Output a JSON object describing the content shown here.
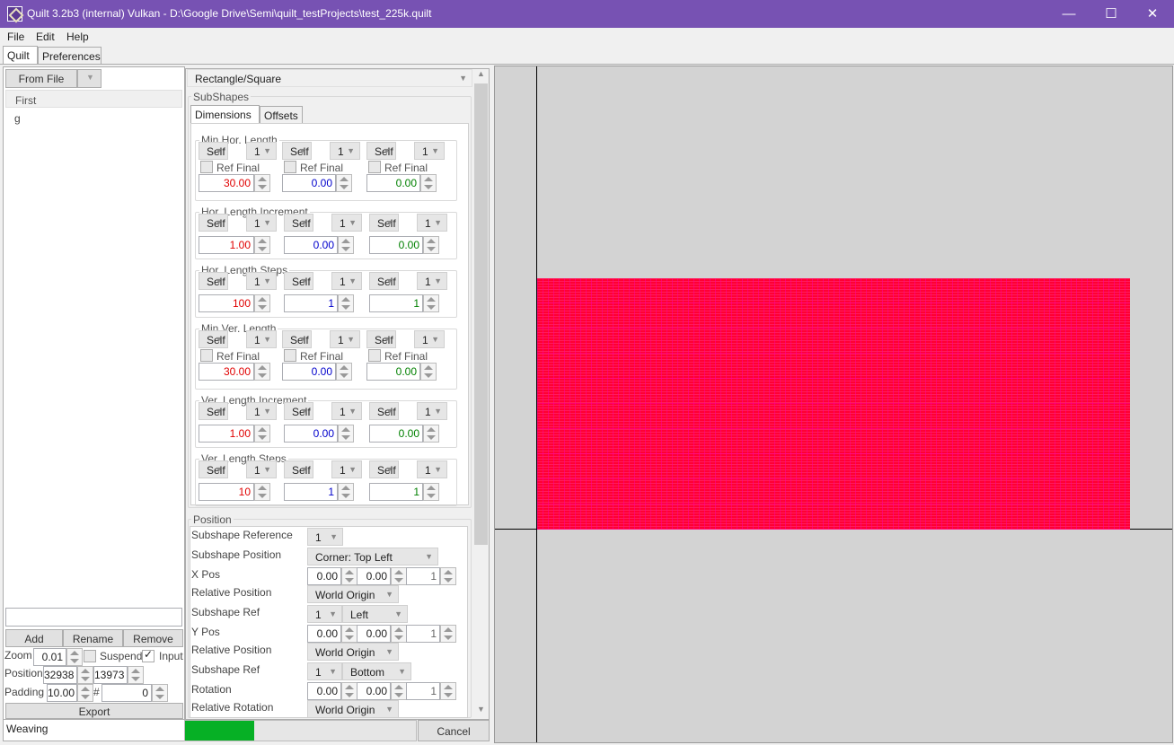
{
  "window": {
    "title": "Quilt 3.2b3 (internal) Vulkan - D:\\Google Drive\\Semi\\quilt_testProjects\\test_225k.quilt",
    "minimize": "—",
    "maximize": "☐",
    "close": "✕"
  },
  "menu": [
    "File",
    "Edit",
    "Help"
  ],
  "tabs": [
    "Quilt",
    "Preferences"
  ],
  "left": {
    "from_file": "From File",
    "list_header": "First",
    "list_items": [
      "g"
    ],
    "add": "Add",
    "rename": "Rename",
    "remove": "Remove",
    "zoom_label": "Zoom",
    "zoom": "0.01",
    "suspend": "Suspend",
    "input": "Input",
    "position_label": "Position",
    "pos_x": "32938",
    "pos_y": "13973",
    "padding_label": "Padding",
    "padding": "10.00",
    "hash": "#",
    "hash_val": "0",
    "export": "Export",
    "status": "Weaving"
  },
  "shape": {
    "type": "Rectangle/Square",
    "subshapes": "SubShapes",
    "subtabs": [
      "Dimensions",
      "Offsets"
    ],
    "self": "Self",
    "one": "1",
    "ref_final": "Ref Final",
    "groups": [
      {
        "title": "Min Hor. Length",
        "values": [
          "30.00",
          "0.00",
          "0.00"
        ],
        "ref": true
      },
      {
        "title": "Hor. Length Increment",
        "values": [
          "1.00",
          "0.00",
          "0.00"
        ],
        "ref": false
      },
      {
        "title": "Hor. Length Steps",
        "values": [
          "100",
          "1",
          "1"
        ],
        "ref": false
      },
      {
        "title": "Min Ver. Length",
        "values": [
          "30.00",
          "0.00",
          "0.00"
        ],
        "ref": true
      },
      {
        "title": "Ver. Length Increment",
        "values": [
          "1.00",
          "0.00",
          "0.00"
        ],
        "ref": false
      },
      {
        "title": "Ver. Length Steps",
        "values": [
          "10",
          "1",
          "1"
        ],
        "ref": false
      }
    ]
  },
  "position": {
    "title": "Position",
    "subshape_reference": "Subshape Reference",
    "subshape_reference_val": "1",
    "subshape_position": "Subshape Position",
    "subshape_position_val": "Corner: Top Left",
    "xpos": "X Pos",
    "xpos_vals": [
      "0.00",
      "0.00",
      "1"
    ],
    "relpos1": "Relative Position",
    "relpos1_val": "World Origin",
    "subref1": "Subshape Ref",
    "subref1_num": "1",
    "subref1_side": "Left",
    "ypos": "Y Pos",
    "ypos_vals": [
      "0.00",
      "0.00",
      "1"
    ],
    "relpos2": "Relative Position",
    "relpos2_val": "World Origin",
    "subref2": "Subshape Ref",
    "subref2_num": "1",
    "subref2_side": "Bottom",
    "rotation": "Rotation",
    "rotation_vals": [
      "0.00",
      "0.00",
      "1"
    ],
    "relrot": "Relative Rotation",
    "relrot_val": "World Origin"
  },
  "progress": {
    "fraction": 0.3,
    "cancel": "Cancel"
  },
  "colors": {
    "accent": "#7752b3",
    "pattern": "#ff0033",
    "progress": "#06b025"
  }
}
